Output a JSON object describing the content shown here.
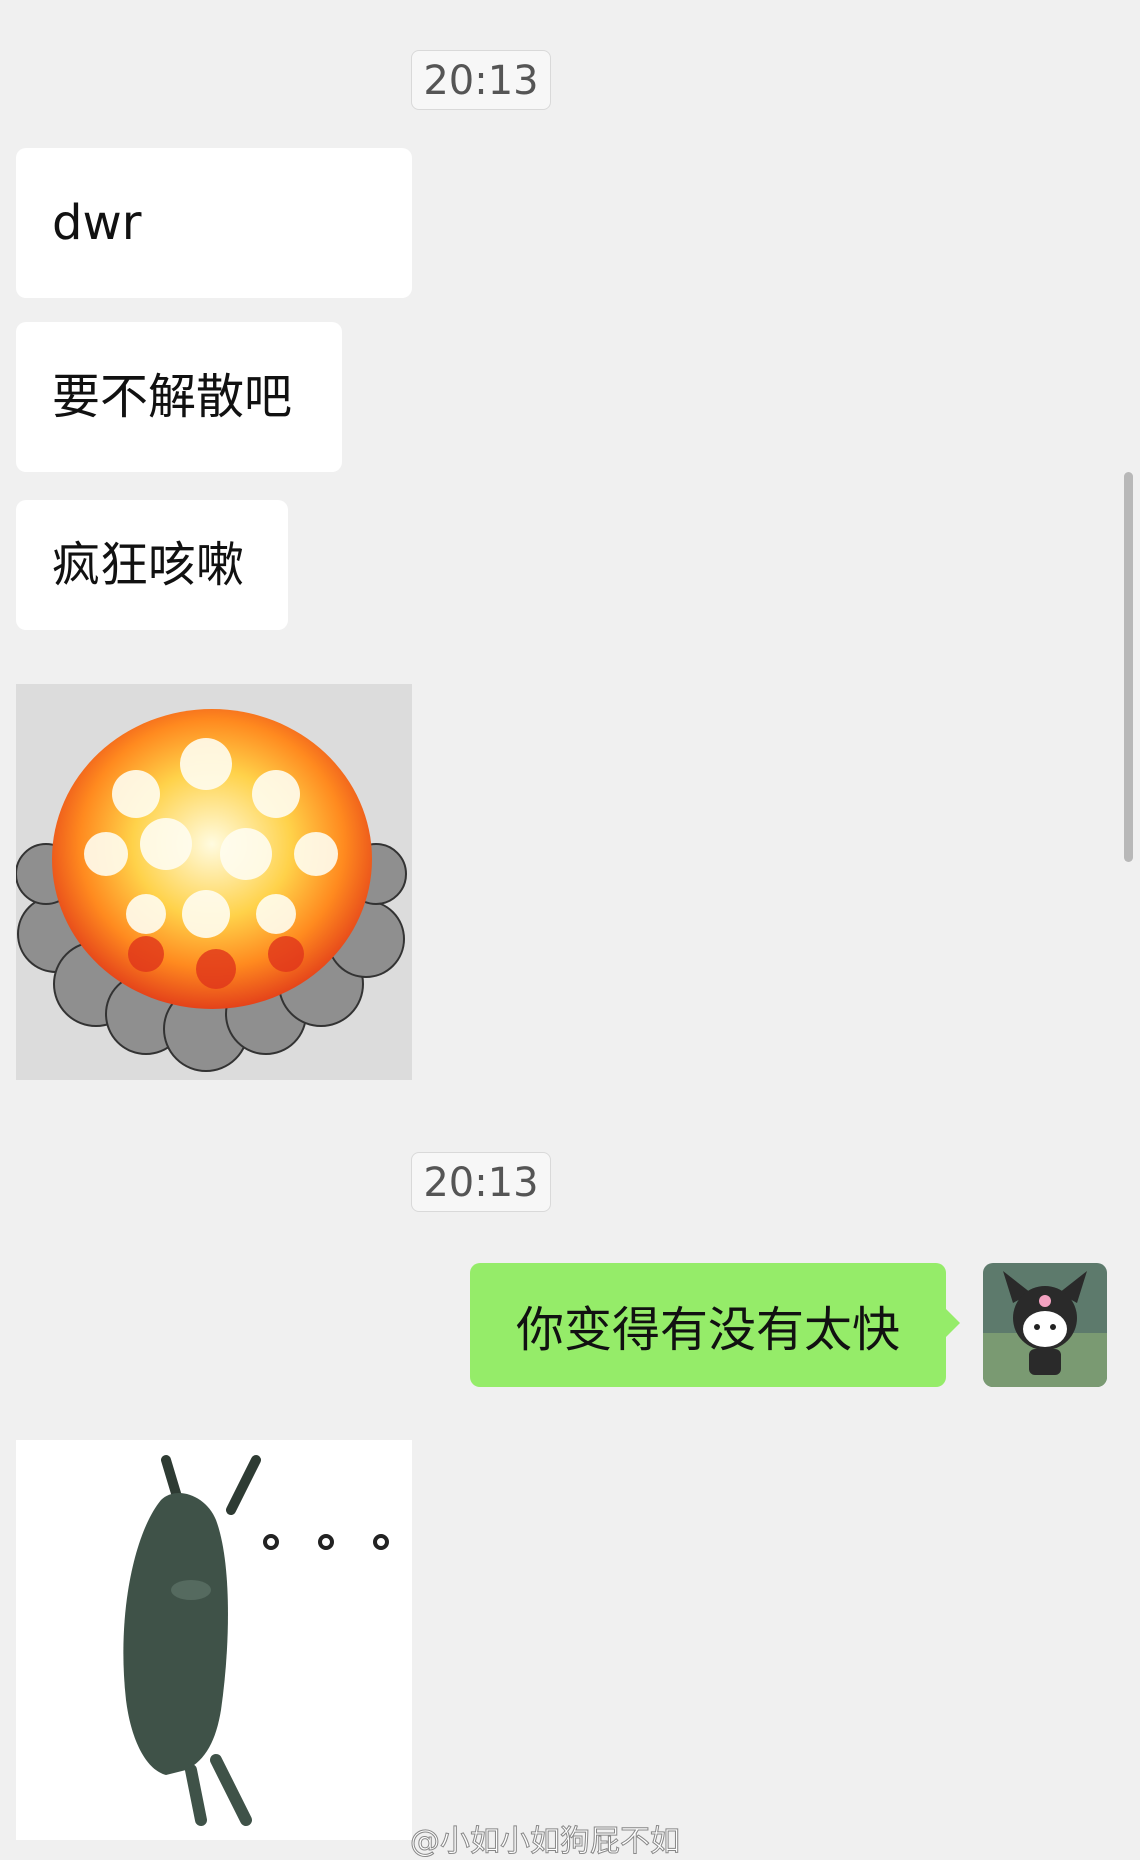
{
  "chat": {
    "messages": [
      {
        "type": "timestamp",
        "text": "20:13"
      },
      {
        "type": "incoming_text",
        "text": "dwr"
      },
      {
        "type": "incoming_text",
        "text": "要不解散吧"
      },
      {
        "type": "incoming_text",
        "text": "疯狂咳嗽"
      },
      {
        "type": "incoming_sticker",
        "sticker": "explosion-sticker"
      },
      {
        "type": "timestamp",
        "text": "20:13"
      },
      {
        "type": "outgoing_text",
        "text": "你变得有没有太快"
      },
      {
        "type": "incoming_sticker",
        "sticker": "ghost-dots-sticker"
      }
    ],
    "sender_avatar": "kuromi-avatar",
    "accent_color": "#95ec69"
  },
  "watermark": {
    "text": "@小如小如狗屁不如"
  }
}
